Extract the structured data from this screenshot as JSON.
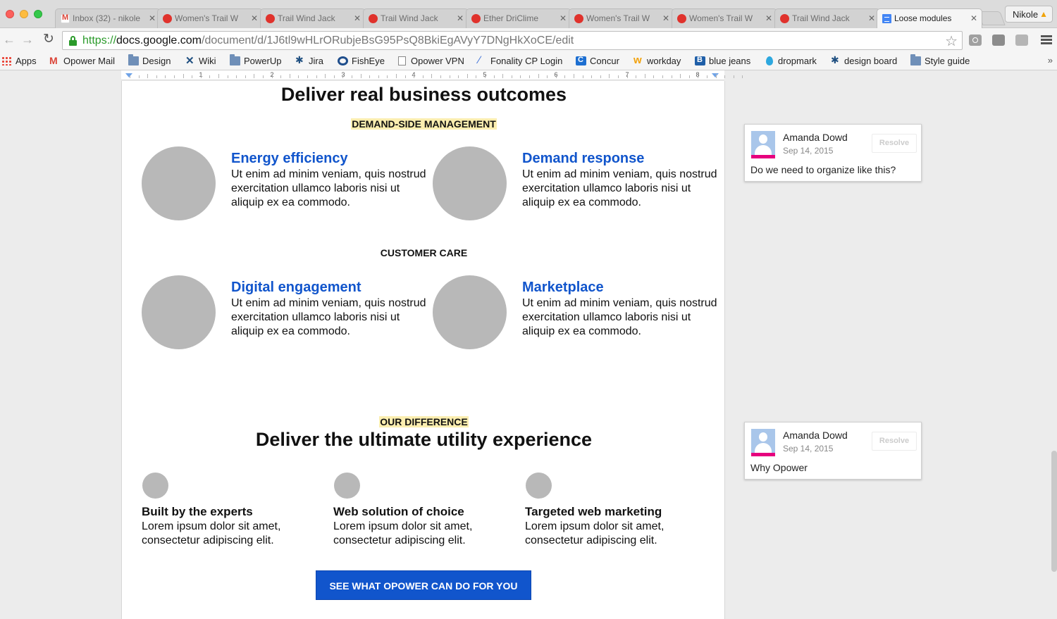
{
  "browser": {
    "tabs": [
      {
        "title": "Inbox (32) - nikole",
        "icon": "gmail-icon"
      },
      {
        "title": "Women's Trail W",
        "icon": "red-circle-icon"
      },
      {
        "title": "Trail Wind Jack",
        "icon": "red-circle-icon"
      },
      {
        "title": "Trail Wind Jack",
        "icon": "red-circle-icon"
      },
      {
        "title": "Ether DriClime",
        "icon": "red-circle-icon"
      },
      {
        "title": "Women's Trail W",
        "icon": "red-circle-icon"
      },
      {
        "title": "Women's Trail W",
        "icon": "red-circle-icon"
      },
      {
        "title": "Trail Wind Jack",
        "icon": "red-circle-icon"
      },
      {
        "title": "Loose modules",
        "icon": "google-docs-icon",
        "active": true
      }
    ],
    "profile_name": "Nikole",
    "url": {
      "scheme": "https://",
      "host": "docs.google.com",
      "path": "/document/d/1J6tl9wHLrORubjeBsG95PsQ8BkiEgAVyY7DNgHkXoCE/edit"
    },
    "bookmarks": [
      {
        "label": "Apps",
        "icon": "apps"
      },
      {
        "label": "Opower Mail",
        "icon": "gmail"
      },
      {
        "label": "Design",
        "icon": "folder"
      },
      {
        "label": "Wiki",
        "icon": "wiki"
      },
      {
        "label": "PowerUp",
        "icon": "folder"
      },
      {
        "label": "Jira",
        "icon": "jira"
      },
      {
        "label": "FishEye",
        "icon": "fisheye"
      },
      {
        "label": "Opower VPN",
        "icon": "page"
      },
      {
        "label": "Fonality CP Login",
        "icon": "fonality"
      },
      {
        "label": "Concur",
        "icon": "concur"
      },
      {
        "label": "workday",
        "icon": "workday"
      },
      {
        "label": "blue jeans",
        "icon": "bj"
      },
      {
        "label": "dropmark",
        "icon": "drop"
      },
      {
        "label": "design board",
        "icon": "jira"
      },
      {
        "label": "Style guide",
        "icon": "folder"
      }
    ],
    "bookmarks_more": "»"
  },
  "ruler": {
    "numbers": [
      "1",
      "2",
      "3",
      "4",
      "5",
      "6",
      "7",
      "8"
    ]
  },
  "doc": {
    "heading1": "Deliver real business outcomes",
    "section1": "DEMAND-SIDE MANAGEMENT",
    "section2": "CUSTOMER CARE",
    "modules": [
      {
        "title": "Energy efficiency",
        "body": "Ut enim ad minim veniam, quis nostrud exercitation ullamco laboris nisi ut aliquip ex ea commodo."
      },
      {
        "title": "Demand response",
        "body": "Ut enim ad minim veniam, quis nostrud exercitation ullamco laboris nisi ut aliquip ex ea commodo."
      },
      {
        "title": "Digital engagement",
        "body": "Ut enim ad minim veniam, quis nostrud exercitation ullamco laboris nisi ut aliquip ex ea commodo."
      },
      {
        "title": "Marketplace",
        "body": "Ut enim ad minim veniam, quis nostrud exercitation ullamco laboris nisi ut aliquip ex ea commodo."
      }
    ],
    "eyebrow2": "OUR DIFFERENCE",
    "heading2": "Deliver the ultimate utility experience",
    "features": [
      {
        "title": "Built by the experts",
        "body": "Lorem ipsum dolor sit amet, consectetur adipiscing elit."
      },
      {
        "title": "Web solution of choice",
        "body": "Lorem ipsum dolor sit amet, consectetur adipiscing elit."
      },
      {
        "title": "Targeted web marketing",
        "body": "Lorem ipsum dolor sit amet, consectetur adipiscing elit."
      }
    ],
    "cta_label": "SEE WHAT OPOWER CAN DO FOR YOU"
  },
  "comments": [
    {
      "author": "Amanda Dowd",
      "date": "Sep 14, 2015",
      "resolve": "Resolve",
      "text": "Do we need to organize like this?"
    },
    {
      "author": "Amanda Dowd",
      "date": "Sep 14, 2015",
      "resolve": "Resolve",
      "text": "Why Opower"
    }
  ],
  "colors": {
    "link_blue": "#1155cc",
    "highlight": "#fbeeb0",
    "placeholder_gray": "#b8b8b8",
    "avatar_accent": "#e6007e"
  }
}
